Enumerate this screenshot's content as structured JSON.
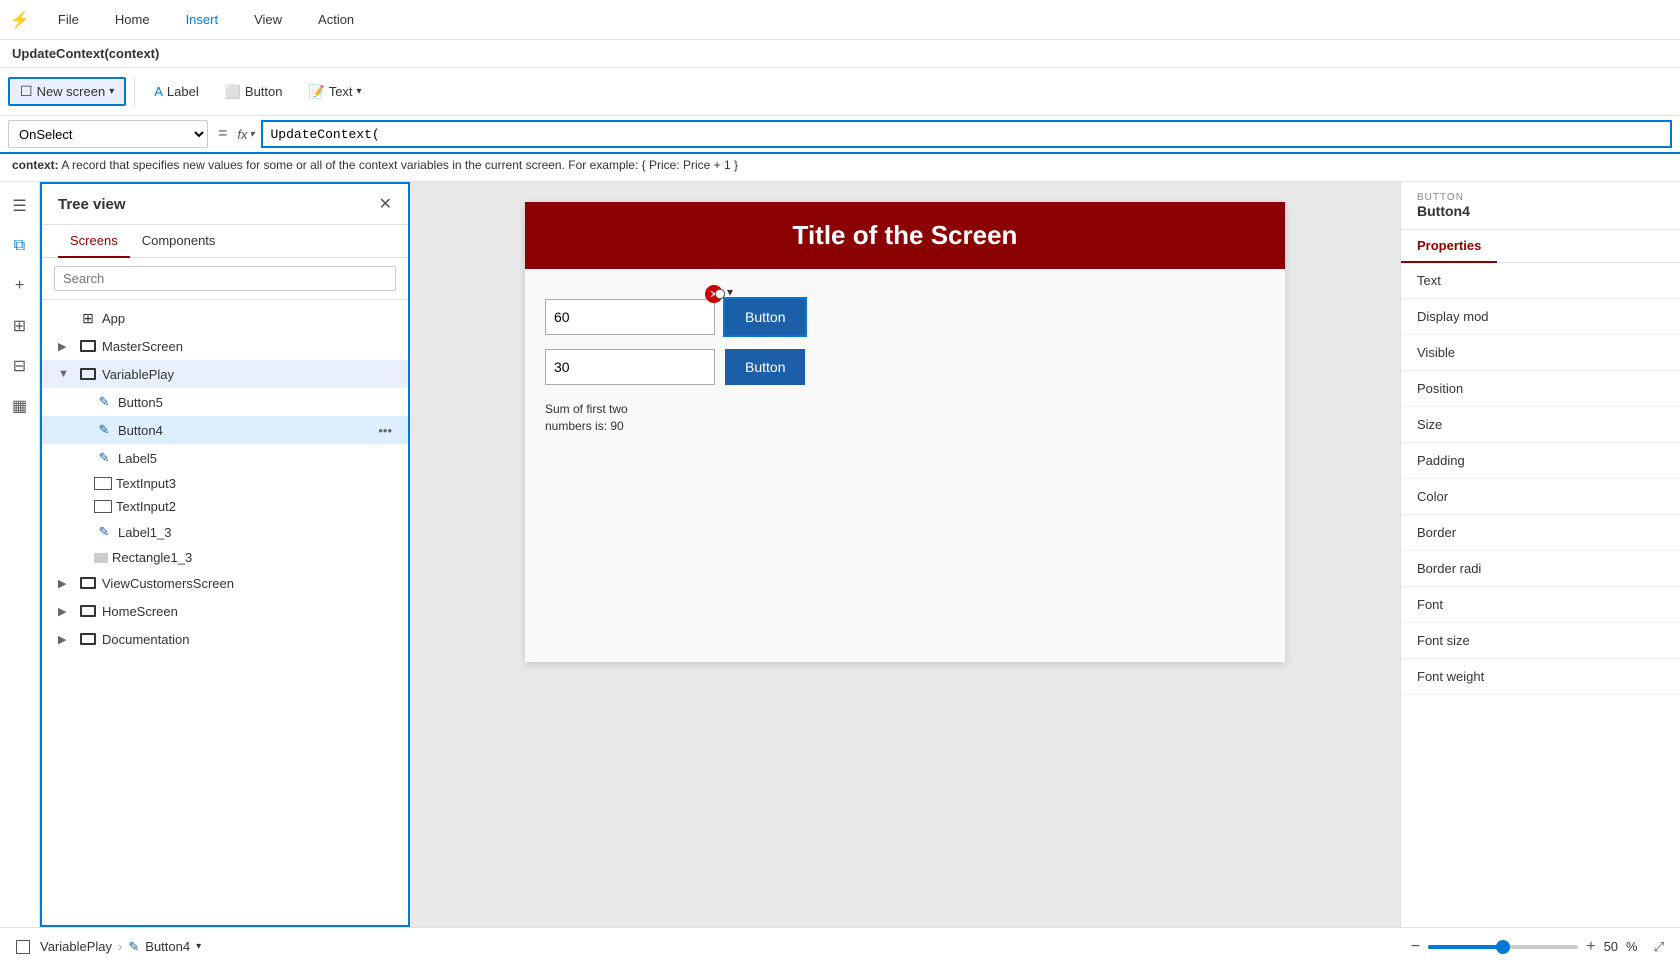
{
  "menu": {
    "items": [
      {
        "label": "File",
        "active": false
      },
      {
        "label": "Home",
        "active": false
      },
      {
        "label": "Insert",
        "active": true
      },
      {
        "label": "View",
        "active": false
      },
      {
        "label": "Action",
        "active": false
      }
    ]
  },
  "toolbar": {
    "new_screen_label": "New screen",
    "label_label": "Label",
    "button_label": "Button",
    "text_label": "Text"
  },
  "formula_bar": {
    "property": "OnSelect",
    "formula": "UpdateContext(",
    "cursor": true
  },
  "tooltip": {
    "param": "context:",
    "description": "A record that specifies new values for some or all of the context variables in the current screen. For example: { Price: Price + 1 }"
  },
  "formula_header": {
    "title": "UpdateContext(context)"
  },
  "tree_view": {
    "title": "Tree view",
    "tabs": [
      {
        "label": "Screens",
        "active": true
      },
      {
        "label": "Components",
        "active": false
      }
    ],
    "search_placeholder": "Search",
    "items": [
      {
        "id": "app",
        "label": "App",
        "level": 0,
        "type": "app",
        "expanded": false,
        "chevron": ""
      },
      {
        "id": "masterscreen",
        "label": "MasterScreen",
        "level": 0,
        "type": "screen",
        "expanded": false,
        "chevron": "▶"
      },
      {
        "id": "variableplay",
        "label": "VariablePlay",
        "level": 0,
        "type": "screen",
        "expanded": true,
        "chevron": "▼",
        "selected": true
      },
      {
        "id": "button5",
        "label": "Button5",
        "level": 1,
        "type": "button"
      },
      {
        "id": "button4",
        "label": "Button4",
        "level": 1,
        "type": "button",
        "active": true
      },
      {
        "id": "label5",
        "label": "Label5",
        "level": 1,
        "type": "label"
      },
      {
        "id": "textinput3",
        "label": "TextInput3",
        "level": 1,
        "type": "textinput"
      },
      {
        "id": "textinput2",
        "label": "TextInput2",
        "level": 1,
        "type": "textinput"
      },
      {
        "id": "label1_3",
        "label": "Label1_3",
        "level": 1,
        "type": "label"
      },
      {
        "id": "rectangle1_3",
        "label": "Rectangle1_3",
        "level": 1,
        "type": "rectangle"
      },
      {
        "id": "viewcustomersscreen",
        "label": "ViewCustomersScreen",
        "level": 0,
        "type": "screen",
        "expanded": false,
        "chevron": "▶"
      },
      {
        "id": "homescreen",
        "label": "HomeScreen",
        "level": 0,
        "type": "screen",
        "expanded": false,
        "chevron": "▶"
      },
      {
        "id": "documentation",
        "label": "Documentation",
        "level": 0,
        "type": "screen",
        "expanded": false,
        "chevron": "▶"
      }
    ]
  },
  "canvas": {
    "title": "Title of the Screen",
    "input1_value": "60",
    "input2_value": "30",
    "button_label": "Button",
    "sum_label": "Sum of first two\nnumbers is: 90"
  },
  "properties_panel": {
    "section_label": "BUTTON",
    "element_name": "Button4",
    "tabs": [
      {
        "label": "Properties",
        "active": true
      }
    ],
    "items": [
      {
        "label": "Text"
      },
      {
        "label": "Display mod"
      },
      {
        "label": "Visible"
      },
      {
        "label": "Position"
      },
      {
        "label": "Size"
      },
      {
        "label": "Padding"
      },
      {
        "label": "Color"
      },
      {
        "label": "Border"
      },
      {
        "label": "Border radi"
      },
      {
        "label": "Font"
      },
      {
        "label": "Font size"
      },
      {
        "label": "Font weight"
      }
    ]
  },
  "status_bar": {
    "screen_label": "VariablePlay",
    "element_label": "Button4",
    "zoom_value": "50",
    "zoom_unit": "%"
  },
  "icons": {
    "hamburger": "☰",
    "layers": "⧉",
    "plus": "+",
    "components": "⊞",
    "data": "⊟",
    "media": "▦",
    "close": "✕",
    "search": "🔍",
    "zoom_minus": "−",
    "zoom_plus": "+",
    "expand": "⤢",
    "chevron_down": "⌄",
    "screen_icon": "□",
    "arrow_right": "→",
    "fx": "fx",
    "equals": "="
  }
}
